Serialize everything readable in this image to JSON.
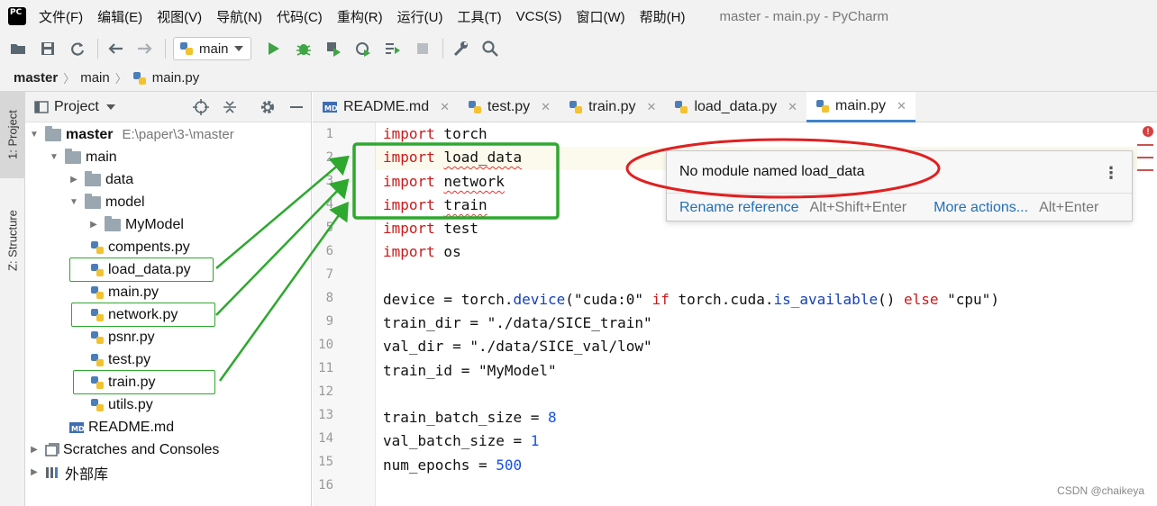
{
  "app": {
    "logo_text": "PC",
    "window_title": "master - main.py - PyCharm",
    "menu": [
      "文件(F)",
      "编辑(E)",
      "视图(V)",
      "导航(N)",
      "代码(C)",
      "重构(R)",
      "运行(U)",
      "工具(T)",
      "VCS(S)",
      "窗口(W)",
      "帮助(H)"
    ]
  },
  "toolbar": {
    "run_config": "main",
    "icons": [
      "open-folder-icon",
      "save-icon",
      "sync-icon",
      "back-icon",
      "forward-icon",
      "run-icon",
      "debug-icon",
      "coverage-icon",
      "profile-icon",
      "run-with-icon",
      "stop-icon",
      "settings-wrench-icon",
      "search-icon"
    ]
  },
  "breadcrumb": [
    "master",
    "main",
    "main.py"
  ],
  "tool_stripe": {
    "project": "1: Project",
    "structure": "Z: Structure"
  },
  "project_panel": {
    "title": "Project",
    "root_name": "master",
    "root_path": "E:\\paper\\3-\\master",
    "tree": [
      {
        "label": "main",
        "kind": "folder"
      },
      {
        "label": "data",
        "kind": "folder"
      },
      {
        "label": "model",
        "kind": "folder"
      },
      {
        "label": "MyModel",
        "kind": "folder"
      },
      {
        "label": "compents.py",
        "kind": "py"
      },
      {
        "label": "load_data.py",
        "kind": "py"
      },
      {
        "label": "main.py",
        "kind": "py"
      },
      {
        "label": "network.py",
        "kind": "py"
      },
      {
        "label": "psnr.py",
        "kind": "py"
      },
      {
        "label": "test.py",
        "kind": "py"
      },
      {
        "label": "train.py",
        "kind": "py"
      },
      {
        "label": "utils.py",
        "kind": "py"
      },
      {
        "label": "README.md",
        "kind": "md"
      },
      {
        "label": "Scratches and Consoles",
        "kind": "scratch"
      },
      {
        "label": "外部库",
        "kind": "lib"
      }
    ]
  },
  "tabs": [
    {
      "label": "README.md",
      "kind": "md"
    },
    {
      "label": "test.py",
      "kind": "py"
    },
    {
      "label": "train.py",
      "kind": "py"
    },
    {
      "label": "load_data.py",
      "kind": "py"
    },
    {
      "label": "main.py",
      "kind": "py",
      "active": true
    }
  ],
  "editor": {
    "line_numbers": [
      "1",
      "2",
      "3",
      "4",
      "5",
      "6",
      "7",
      "8",
      "9",
      "10",
      "11",
      "12",
      "13",
      "14",
      "15",
      "16"
    ],
    "code": {
      "kw_import": "import",
      "l1_mod": " torch",
      "l2_mod": "load_data",
      "l3_mod": "network",
      "l4_mod": "train",
      "l5_mod": " test",
      "l6_mod": " os",
      "l8_a": "device = torch.",
      "l8_fn1": "device",
      "l8_b": "(\"cuda:0\" ",
      "l8_if": "if",
      "l8_c": " torch.cuda.",
      "l8_fn2": "is_available",
      "l8_d": "() ",
      "l8_else": "else",
      "l8_e": " \"cpu\")",
      "l9": "train_dir = \"./data/SICE_train\"",
      "l10": "val_dir = \"./data/SICE_val/low\"",
      "l11": "train_id = \"MyModel\"",
      "l13_a": "train_batch_size = ",
      "l13_n": "8",
      "l14_a": "val_batch_size = ",
      "l14_n": "1",
      "l15_a": "num_epochs = ",
      "l15_n": "500"
    }
  },
  "popup": {
    "message": "No module named load_data",
    "action1": "Rename reference",
    "action1_key": "Alt+Shift+Enter",
    "action2": "More actions...",
    "action2_key": "Alt+Enter"
  },
  "watermark": "CSDN @chaikeya",
  "colors": {
    "annotation_green": "#2ea82e",
    "annotation_red": "#e02020",
    "keyword": "#cc1a1a",
    "number": "#1750eb",
    "link": "#2470b3"
  }
}
